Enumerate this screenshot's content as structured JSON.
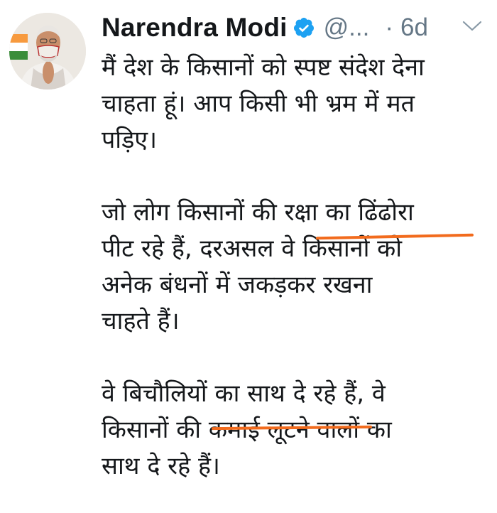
{
  "tweet": {
    "display_name": "Narendra Modi",
    "handle": "@...",
    "separator": "·",
    "timestamp": "6d",
    "avatar_icon": "avatar-photo",
    "verified_icon": "verified-badge-icon",
    "menu_icon": "chevron-down-icon",
    "paragraphs": [
      "मैं देश के किसानों को स्पष्ट संदेश देना\nचाहता हूं। आप किसी भी भ्रम में मत\nपड़िए।",
      "जो लोग किसानों की रक्षा का ढिंढोरा\nपीट रहे हैं, दरअसल वे किसानों को\nअनेक बंधनों में जकड़कर रखना\nचाहते हैं।",
      "वे बिचौलियों का साथ दे रहे हैं, वे\nकिसानों की कमाई लूटने वालों का\nसाथ दे रहे हैं।"
    ]
  },
  "colors": {
    "text": "#14171a",
    "secondary": "#657786",
    "verified": "#1da1f2",
    "highlight_underline": "#f26b1d"
  }
}
